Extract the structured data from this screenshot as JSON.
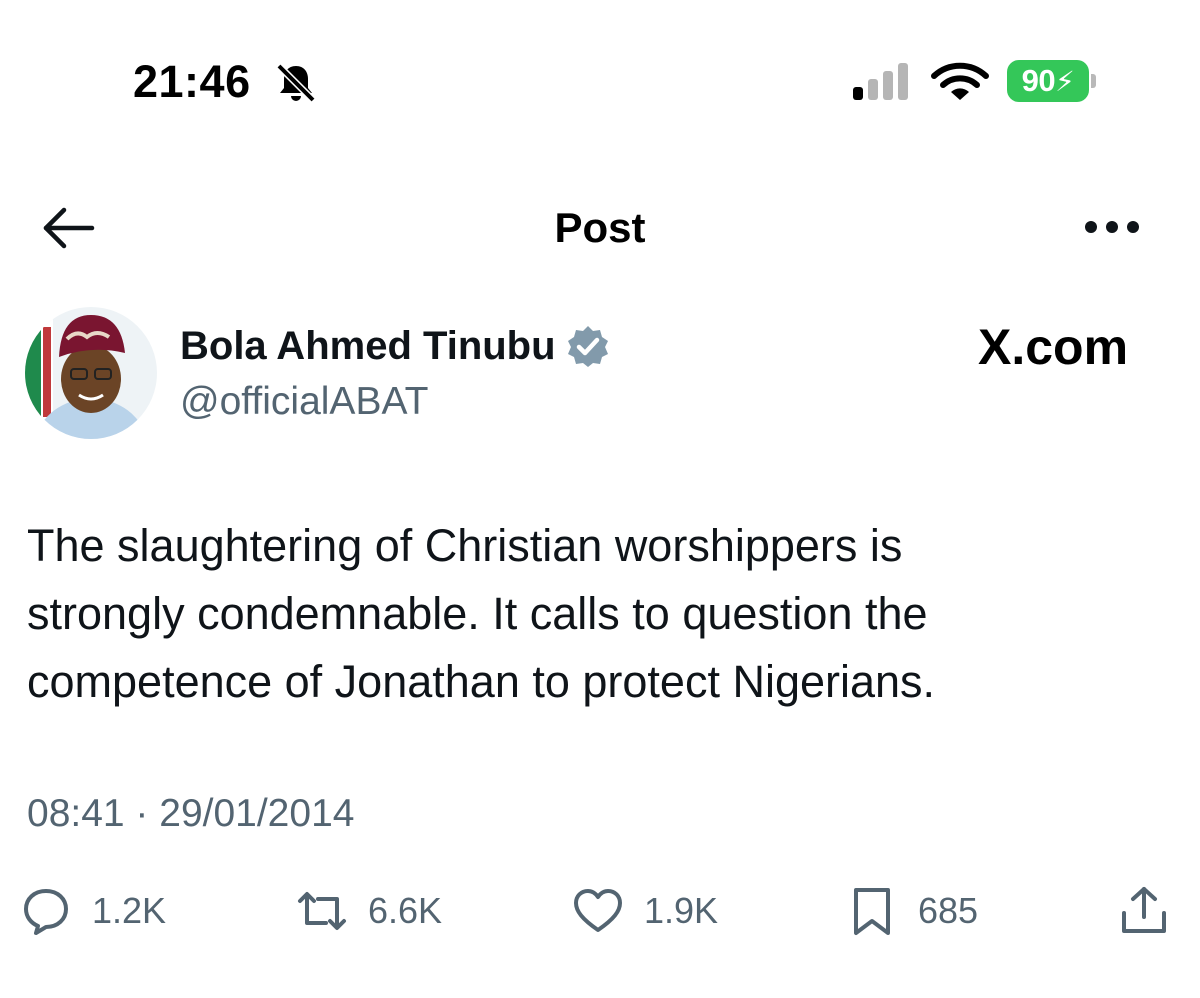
{
  "status_bar": {
    "time": "21:46",
    "battery_percent": "90",
    "battery_color": "#34c759",
    "icons": [
      "bell-slash-icon",
      "signal-icon",
      "wifi-icon",
      "battery-charging-icon"
    ]
  },
  "header": {
    "title": "Post",
    "back_icon": "arrow-left-icon",
    "more_icon": "ellipsis-icon"
  },
  "author": {
    "name": "Bola Ahmed Tinubu",
    "handle": "@officialABAT",
    "verified_icon": "verified-badge-icon"
  },
  "brand": "X.com",
  "post": {
    "text": "The slaughtering of Christian worshippers  is\nstrongly condemnable. It calls to question the\ncompetence of Jonathan to protect Nigerians.",
    "timestamp": "08:41 · 29/01/2014"
  },
  "actions": {
    "replies": "1.2K",
    "reposts": "6.6K",
    "likes": "1.9K",
    "bookmarks": "685"
  },
  "colors": {
    "text": "#0f1419",
    "secondary": "#536471",
    "verified_badge": "#829aab"
  }
}
